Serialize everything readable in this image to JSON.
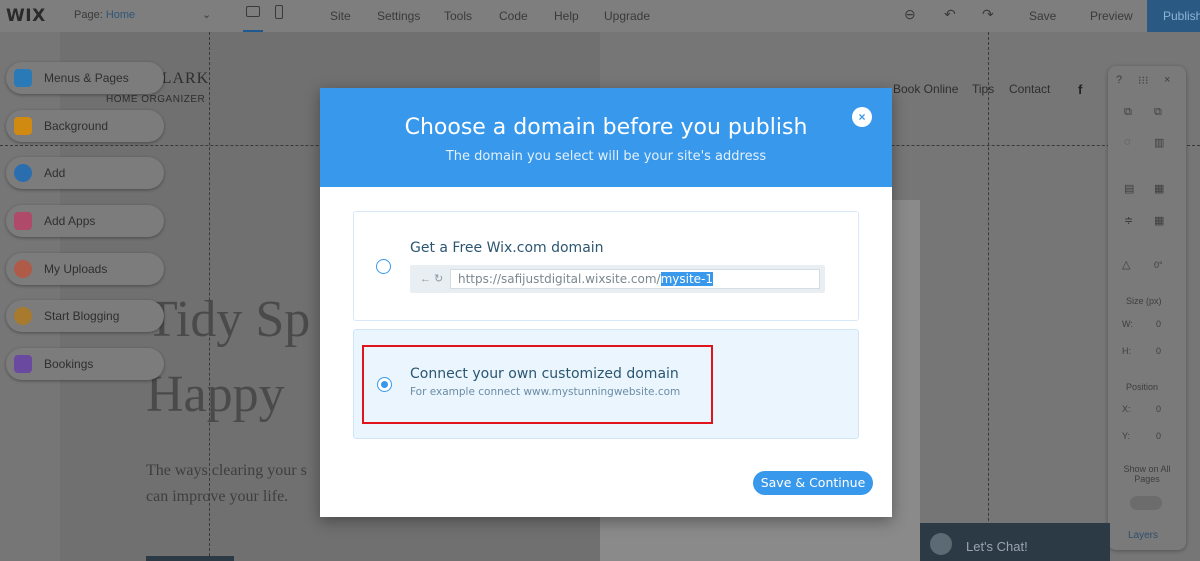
{
  "topbar": {
    "logo": "WIX",
    "page_label": "Page:",
    "page_value": "Home",
    "menu": [
      "Site",
      "Settings",
      "Tools",
      "Code",
      "Help",
      "Upgrade"
    ],
    "save": "Save",
    "preview": "Preview",
    "publish": "Publish"
  },
  "left_panel": {
    "items": [
      {
        "label": "Menus & Pages",
        "color": "#2a7ab8"
      },
      {
        "label": "Background",
        "color": "#d08a12"
      },
      {
        "label": "Add",
        "color": "#2a6eb0"
      },
      {
        "label": "Add Apps",
        "color": "#b04a6a"
      },
      {
        "label": "My Uploads",
        "color": "#b05a48"
      },
      {
        "label": "Start Blogging",
        "color": "#a87a2e"
      },
      {
        "label": "Bookings",
        "color": "#6a4aa0"
      }
    ]
  },
  "site": {
    "logo": "CLARK",
    "logo_sub": "HOME ORGANIZER",
    "nav": [
      "Book Online",
      "Tips",
      "Contact"
    ],
    "facebook_icon": "f",
    "hero_line1": "Tidy Sp",
    "hero_line2": "Happy",
    "hero_text": "The ways clearing your s can improve your life."
  },
  "right_panel": {
    "size_label": "Size (px)",
    "w_label": "W:",
    "h_label": "H:",
    "w_val": "0",
    "h_val": "0",
    "position_label": "Position",
    "x_label": "X:",
    "y_label": "Y:",
    "x_val": "0",
    "y_val": "0",
    "show_all": "Show on All Pages",
    "layers": "Layers"
  },
  "chat": {
    "label": "Let's Chat!"
  },
  "modal": {
    "title": "Choose a domain before you publish",
    "subtitle": "The domain you select will be your site's address",
    "close_icon": "×",
    "option_free": {
      "title": "Get a Free Wix.com domain",
      "url_prefix": "https://safijustdigital.wixsite.com/",
      "url_selected": "mysite-1",
      "selected": false
    },
    "option_custom": {
      "title": "Connect your own customized domain",
      "hint": "For example connect www.mystunningwebsite.com",
      "selected": true
    },
    "save_button": "Save & Continue"
  },
  "colors": {
    "accent": "#3899ec",
    "highlight": "#e0141d"
  }
}
